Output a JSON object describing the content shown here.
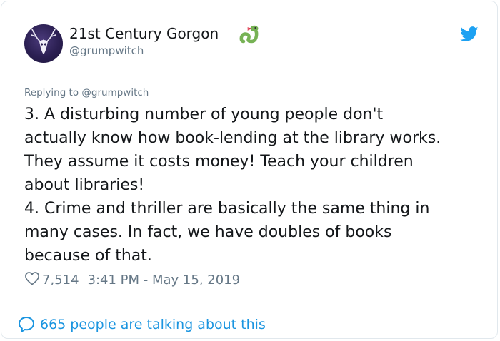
{
  "tweet": {
    "author": {
      "display_name": "21st Century Gorgon",
      "handle": "@grumpwitch",
      "avatar_icon": "stag-skull-icon",
      "name_emoji_icon": "snake-emoji-icon"
    },
    "replying_to": "Replying to @grumpwitch",
    "text": "3. A disturbing number of young people don't\nactually know how book-lending at the library works.\nThey assume it costs money! Teach your children\nabout libraries!\n4. Crime and thriller are basically the same thing in\nmany cases. In fact, we have doubles of books\nbecause of that.",
    "likes": "7,514",
    "timestamp": "3:41 PM - May 15, 2019",
    "talking_about": "665 people are talking about this"
  },
  "icons": {
    "platform": "twitter-bird-icon",
    "like": "heart-outline-icon",
    "conversation": "speech-bubble-icon"
  },
  "colors": {
    "text": "#14171a",
    "secondary": "#657786",
    "accent": "#1da1f2",
    "link": "#1b95e0",
    "border": "#e1e8ed"
  }
}
